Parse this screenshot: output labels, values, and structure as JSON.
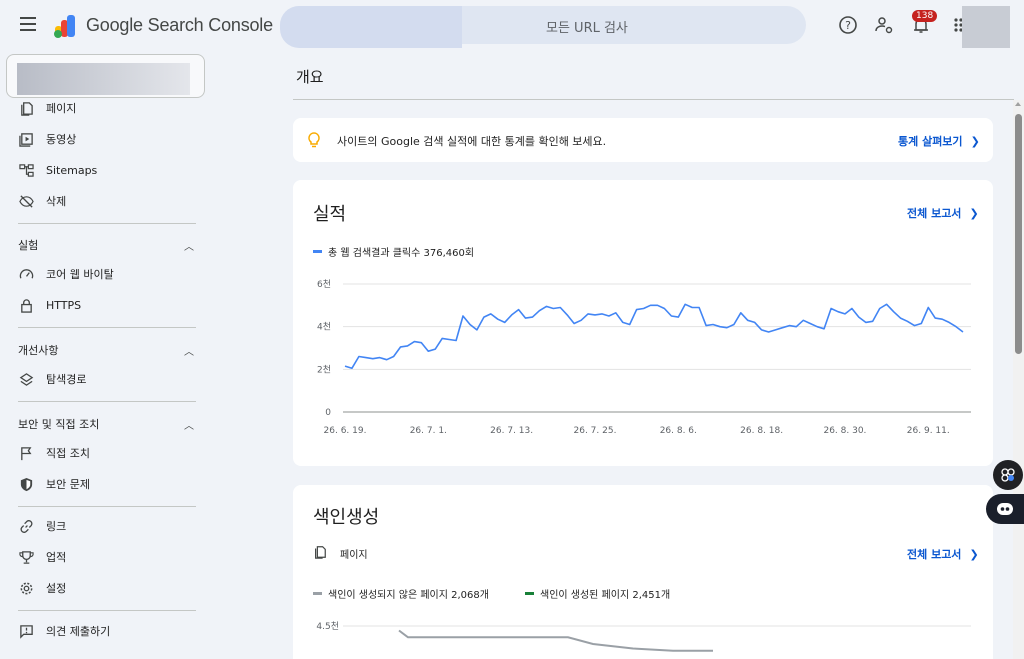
{
  "topbar": {
    "brand": "Google Search Console",
    "search_placeholder": "모든 URL 검사",
    "notifications_count": "138"
  },
  "sidebar": {
    "items_top": [
      {
        "label": "페이지",
        "icon": "pages-icon"
      },
      {
        "label": "동영상",
        "icon": "video-icon"
      },
      {
        "label": "Sitemaps",
        "icon": "sitemap-icon"
      },
      {
        "label": "삭제",
        "icon": "removal-icon"
      }
    ],
    "sections": [
      {
        "title": "실험",
        "items": [
          {
            "label": "코어 웹 바이탈",
            "icon": "gauge-icon"
          },
          {
            "label": "HTTPS",
            "icon": "lock-icon"
          }
        ]
      },
      {
        "title": "개선사항",
        "items": [
          {
            "label": "탐색경로",
            "icon": "layers-icon"
          }
        ]
      },
      {
        "title": "보안 및 직접 조치",
        "items": [
          {
            "label": "직접 조치",
            "icon": "flag-icon"
          },
          {
            "label": "보안 문제",
            "icon": "shield-icon"
          }
        ]
      }
    ],
    "items_bottom": [
      {
        "label": "링크",
        "icon": "link-icon"
      },
      {
        "label": "업적",
        "icon": "trophy-icon"
      },
      {
        "label": "설정",
        "icon": "gear-icon"
      }
    ],
    "feedback": "의견 제출하기"
  },
  "main": {
    "title": "개요",
    "tip": {
      "text": "사이트의 Google 검색 실적에 대한 통계를 확인해 보세요.",
      "link": "통계 살펴보기"
    },
    "performance": {
      "title": "실적",
      "full_report": "전체 보고서",
      "legend": "총 웹 검색결과 클릭수 376,460회",
      "legend_color": "#4285f4"
    },
    "indexing": {
      "title": "색인생성",
      "subtitle": "페이지",
      "full_report": "전체 보고서",
      "legend_not_indexed": "색인이 생성되지 않은 페이지 2,068개",
      "legend_indexed": "색인이 생성된 페이지 2,451개",
      "not_indexed_color": "#9aa0a6",
      "indexed_color": "#188038",
      "y_top_label": "4.5천"
    }
  },
  "chart_data": [
    {
      "type": "line",
      "title": "",
      "xlabel": "",
      "ylabel": "",
      "y_tick_labels": [
        "0",
        "2천",
        "4천",
        "6천"
      ],
      "y_ticks": [
        0,
        2000,
        4000,
        6000
      ],
      "ylim": [
        0,
        6000
      ],
      "x_tick_labels": [
        "26. 6. 19.",
        "26. 7. 1.",
        "26. 7. 13.",
        "26. 7. 25.",
        "26. 8. 6.",
        "26. 8. 18.",
        "26. 8. 30.",
        "26. 9. 11."
      ],
      "grid": true,
      "series": [
        {
          "name": "총 웹 검색결과 클릭수",
          "color": "#4285f4",
          "x": [
            "26. 6. 19.",
            "26. 6. 20.",
            "26. 6. 21.",
            "26. 6. 22.",
            "26. 6. 23.",
            "26. 6. 24.",
            "26. 6. 25.",
            "26. 6. 26.",
            "26. 6. 27.",
            "26. 6. 28.",
            "26. 6. 29.",
            "26. 6. 30.",
            "26. 7. 1.",
            "26. 7. 2.",
            "26. 7. 3.",
            "26. 7. 4.",
            "26. 7. 5.",
            "26. 7. 6.",
            "26. 7. 7.",
            "26. 7. 8.",
            "26. 7. 9.",
            "26. 7. 10.",
            "26. 7. 11.",
            "26. 7. 12.",
            "26. 7. 13.",
            "26. 7. 14.",
            "26. 7. 15.",
            "26. 7. 16.",
            "26. 7. 17.",
            "26. 7. 18.",
            "26. 7. 19.",
            "26. 7. 20.",
            "26. 7. 21.",
            "26. 7. 22.",
            "26. 7. 23.",
            "26. 7. 24.",
            "26. 7. 25.",
            "26. 7. 26.",
            "26. 7. 27.",
            "26. 7. 28.",
            "26. 7. 29.",
            "26. 7. 30.",
            "26. 7. 31.",
            "26. 8. 1.",
            "26. 8. 2.",
            "26. 8. 3.",
            "26. 8. 4.",
            "26. 8. 5.",
            "26. 8. 6.",
            "26. 8. 7.",
            "26. 8. 8.",
            "26. 8. 9.",
            "26. 8. 10.",
            "26. 8. 11.",
            "26. 8. 12.",
            "26. 8. 13.",
            "26. 8. 14.",
            "26. 8. 15.",
            "26. 8. 16.",
            "26. 8. 17.",
            "26. 8. 18.",
            "26. 8. 19.",
            "26. 8. 20.",
            "26. 8. 21.",
            "26. 8. 22.",
            "26. 8. 23.",
            "26. 8. 24.",
            "26. 8. 25.",
            "26. 8. 26.",
            "26. 8. 27.",
            "26. 8. 28.",
            "26. 8. 29.",
            "26. 8. 30.",
            "26. 8. 31.",
            "26. 9. 1.",
            "26. 9. 2.",
            "26. 9. 3.",
            "26. 9. 4.",
            "26. 9. 5.",
            "26. 9. 6.",
            "26. 9. 7.",
            "26. 9. 8.",
            "26. 9. 9.",
            "26. 9. 10.",
            "26. 9. 11.",
            "26. 9. 12.",
            "26. 9. 13.",
            "26. 9. 14.",
            "26. 9. 15.",
            "26. 9. 16."
          ],
          "values": [
            2150,
            2050,
            2600,
            2550,
            2500,
            2550,
            2450,
            2600,
            3050,
            3100,
            3300,
            3250,
            2850,
            2950,
            3450,
            3400,
            3350,
            4500,
            4100,
            3850,
            4450,
            4600,
            4350,
            4200,
            4550,
            4800,
            4400,
            4450,
            4750,
            4950,
            4850,
            4900,
            4550,
            4150,
            4300,
            4600,
            4550,
            4600,
            4500,
            4650,
            4200,
            4100,
            4800,
            4850,
            5000,
            5000,
            4850,
            4500,
            4450,
            5050,
            4900,
            4900,
            4050,
            4100,
            4000,
            3950,
            4100,
            4650,
            4300,
            4200,
            3850,
            3750,
            3850,
            3950,
            4050,
            4000,
            4300,
            4150,
            4000,
            3900,
            4850,
            4700,
            4600,
            4850,
            4450,
            4200,
            4250,
            4850,
            5050,
            4700,
            4400,
            4250,
            4050,
            4150,
            4900,
            4400,
            4350,
            4200,
            4000,
            3750
          ]
        }
      ]
    },
    {
      "type": "line",
      "title": "",
      "y_tick_labels": [
        "4.5천"
      ],
      "series": [
        {
          "name": "색인이 생성되지 않은 페이지",
          "color": "#9aa0a6",
          "values": [
            4400,
            4250,
            4250,
            4250,
            4250,
            4250,
            4100,
            4000,
            3950,
            3950
          ]
        },
        {
          "name": "색인이 생성된 페이지",
          "color": "#188038",
          "values": []
        }
      ]
    }
  ]
}
